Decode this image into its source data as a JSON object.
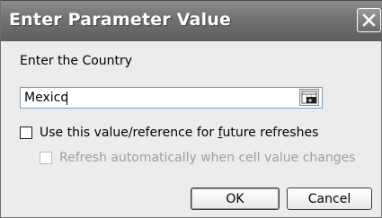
{
  "dialog": {
    "title": "Enter Parameter Value",
    "prompt": "Enter the Country",
    "value": "Mexico",
    "checkbox_future_prefix": "Use this value/reference for ",
    "checkbox_future_underlined": "f",
    "checkbox_future_suffix": "uture refreshes",
    "checkbox_future_checked": false,
    "checkbox_auto_label": "Refresh automatically when cell value changes",
    "checkbox_auto_checked": false,
    "checkbox_auto_enabled": false,
    "ok_label": "OK",
    "cancel_label": "Cancel",
    "icons": [
      "close-icon",
      "collapse-dialog-icon"
    ]
  }
}
